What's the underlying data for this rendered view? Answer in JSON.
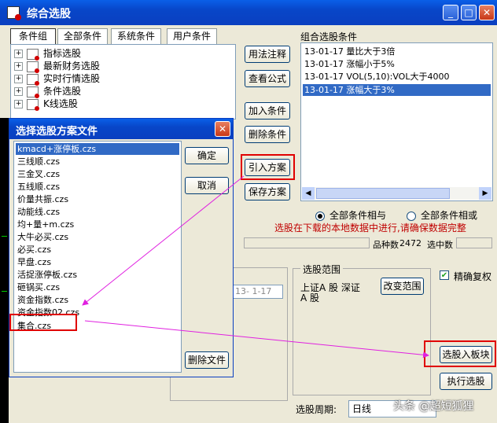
{
  "window": {
    "title": "综合选股",
    "min_label": "_",
    "max_label": "□",
    "close_label": "✕"
  },
  "tabs": [
    "条件组",
    "全部条件",
    "系统条件",
    "用户条件"
  ],
  "tree": [
    "指标选股",
    "最新财务选股",
    "实时行情选股",
    "条件选股",
    "K线选股"
  ],
  "mid_buttons": {
    "usage": "用法注释",
    "formula": "查看公式",
    "add": "加入条件",
    "delete": "删除条件",
    "import": "引入方案",
    "save": "保存方案"
  },
  "conditions": {
    "label": "组合选股条件",
    "items": [
      "13-01-17  量比大于3倍",
      "13-01-17  涨幅小于5%",
      "13-01-17  VOL(5,10):VOL大于4000",
      "13-01-17  涨幅大于3%"
    ],
    "selected_index": 3
  },
  "logic": {
    "and_label": "全部条件相与",
    "or_label": "全部条件相或",
    "selected": "and"
  },
  "notice": "选股在下载的本地数据中进行,请确保数据完整",
  "stats": {
    "count_label": "品种数",
    "count_value": "2472",
    "selected_label": "选中数"
  },
  "date_field": "13- 1-17",
  "range": {
    "label": "选股范围",
    "value_line1": "上证A 股 深证",
    "value_line2": "A 股",
    "change_button": "改变范围"
  },
  "options": {
    "exact_label": "精确复权",
    "exact_checked": true
  },
  "actions": {
    "to_block": "选股入板块",
    "run": "执行选股"
  },
  "period": {
    "label": "选股周期:",
    "value": "日线"
  },
  "watermark": "头条 @超短狐狸",
  "dialog": {
    "title": "选择选股方案文件",
    "ok": "确定",
    "cancel": "取消",
    "delete_file": "删除文件",
    "files": [
      "kmacd+涨停板.czs",
      "三线顺.czs",
      "三金叉.czs",
      "五线顺.czs",
      "价量共振.czs",
      "动能线.czs",
      "均+量+m.czs",
      "大牛必买.czs",
      "必买.czs",
      "早盘.czs",
      "活捉涨停板.czs",
      "砸锅买.czs",
      "资金指数.czs",
      "资金指数02.czs",
      "集合.czs"
    ],
    "selected_index": 0
  },
  "colors": {
    "titlebar": "#0a3fc0",
    "highlight": "#316ac5",
    "annotation": "#e00000",
    "arrow": "#e020e0",
    "notice": "#c00000"
  }
}
